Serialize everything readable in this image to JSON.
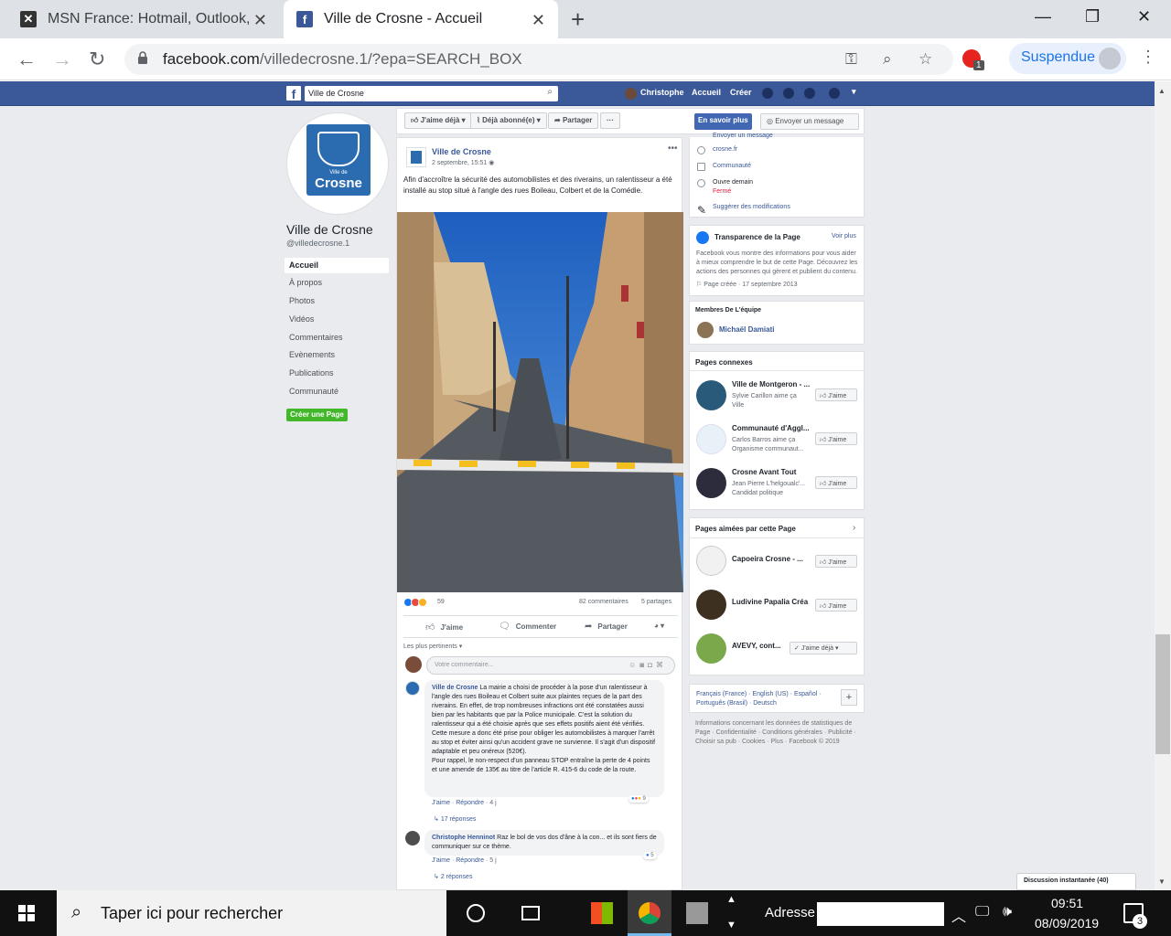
{
  "browser": {
    "tabs": [
      {
        "title": "MSN France: Hotmail, Outlook, actu",
        "active": false
      },
      {
        "title": "Ville de Crosne - Accueil",
        "active": true
      }
    ],
    "url_host": "facebook.com",
    "url_rest": "/villedecrosne.1/?epa=SEARCH_BOX",
    "extension_badge": "1",
    "profile_label": "Suspendue"
  },
  "fb_header": {
    "search_value": "Ville de Crosne",
    "user_name": "Christophe",
    "home": "Accueil",
    "create": "Créer"
  },
  "page": {
    "name": "Ville de Crosne",
    "handle": "@villedecrosne.1",
    "logo_small": "Ville de",
    "logo_big": "Crosne",
    "nav": [
      "Accueil",
      "À propos",
      "Photos",
      "Vidéos",
      "Commentaires",
      "Evènements",
      "Publications",
      "Communauté"
    ],
    "create_page": "Créer une Page"
  },
  "action_bar": {
    "like": "J'aime déjà",
    "follow": "Déjà abonné(e)",
    "share": "Partager",
    "more": "···",
    "learn_more": "En savoir plus",
    "send_message": "Envoyer un message"
  },
  "post": {
    "author": "Ville de Crosne",
    "date": "2 septembre, 15:51",
    "text": "Afin d'accroître la sécurité des automobilistes et des riverains, un ralentisseur a été installé au stop situé à l'angle des rues Boileau, Colbert et de la Comédie.",
    "reactions": "59",
    "comments": "82 commentaires",
    "shares": "5 partages",
    "actions": {
      "like": "J'aime",
      "comment": "Commenter",
      "share": "Partager"
    },
    "sort": "Les plus pertinents",
    "comment_placeholder": "Votre commentaire..."
  },
  "comments": [
    {
      "author": "Ville de Crosne",
      "text": "La mairie a choisi de procéder à la pose d'un ralentisseur à l'angle des rues Boileau et Colbert suite aux plaintes reçues de la part des riverains. En effet, de trop nombreuses infractions ont été constatées aussi bien par les habitants que par la Police municipale. C'est la solution du ralentisseur qui a été choisie après que ses effets positifs aient été vérifiés. Cette mesure a donc été prise pour obliger les automobilistes à marquer l'arrêt au stop et éviter ainsi qu'un accident grave ne survienne. Il s'agit d'un dispositif adaptable et peu onéreux (520€).",
      "text2": "Pour rappel, le non-respect d'un panneau STOP entraîne la perte de 4 points et une amende de 135€ au titre de l'article R. 415-6 du code de la route.",
      "like": "J'aime",
      "reply": "Répondre",
      "age": "4 j",
      "reactions": "9",
      "replies": "17 réponses"
    },
    {
      "author": "Christophe Henninot",
      "text": "Raz le bol de vos dos d'âne à la con... et ils sont fiers de communiquer sur ce thème.",
      "like": "J'aime",
      "reply": "Répondre",
      "age": "5 j",
      "reactions": "5",
      "replies": "2 réponses"
    }
  ],
  "about": {
    "partial_top": "Envoyer un message",
    "website": "crosne.fr",
    "category": "Communauté",
    "hours": "Ouvre demain",
    "closed": "Fermé",
    "suggest": "Suggérer des modifications"
  },
  "transparency": {
    "title": "Transparence de la Page",
    "see_more": "Voir plus",
    "text": "Facebook vous montre des informations pour vous aider à mieux comprendre le but de cette Page. Découvrez les actions des personnes qui gèrent et publient du contenu.",
    "created": "Page créée · 17 septembre 2013"
  },
  "team": {
    "title": "Membres De L'équipe",
    "member": "Michaël Damiati"
  },
  "related": {
    "title": "Pages connexes",
    "items": [
      {
        "name": "Ville de Montgeron - ...",
        "sub": "Sylvie Carillon aime ça",
        "cat": "Ville",
        "btn": "J'aime"
      },
      {
        "name": "Communauté d'Aggl...",
        "sub": "Carlos Barros aime ça",
        "cat": "Organisme communaut...",
        "btn": "J'aime"
      },
      {
        "name": "Crosne Avant Tout",
        "sub": "Jean Pierre L'helgoualc'...",
        "cat": "Candidat politique",
        "btn": "J'aime"
      }
    ]
  },
  "liked": {
    "title": "Pages aimées par cette Page",
    "items": [
      {
        "name": "Capoeira Crosne - ...",
        "btn": "J'aime"
      },
      {
        "name": "Ludivine Papalia Créa",
        "btn": "J'aime"
      },
      {
        "name": "AVEVY, cont...",
        "btn": "J'aime déjà"
      }
    ]
  },
  "languages": "Français (France) · English (US) · Español · Português (Brasil) · Deutsch",
  "footer": "Informations concernant les données de statistiques de Page · Confidentialité · Conditions générales · Publicité · Choisir sa pub · Cookies · Plus · Facebook © 2019",
  "chat": "Discussion instantanée (40)",
  "taskbar": {
    "search": "Taper ici pour rechercher",
    "address_label": "Adresse",
    "time": "09:51",
    "date": "08/09/2019",
    "notifications": "3"
  },
  "colors": {
    "fb_blue": "#3b5998",
    "fb_link": "#385898",
    "chrome_tabbar": "#dee1e6",
    "taskbar": "#111111"
  }
}
